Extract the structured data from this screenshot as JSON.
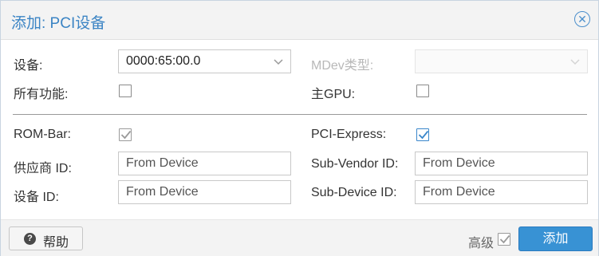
{
  "dialog": {
    "title": "添加: PCI设备",
    "close_icon": "close-circle-icon"
  },
  "fields": {
    "device": {
      "label": "设备:",
      "value": "0000:65:00.0"
    },
    "mdev_type": {
      "label": "MDev类型:",
      "value": "",
      "disabled": true
    },
    "all_functions": {
      "label": "所有功能:",
      "checked": false
    },
    "primary_gpu": {
      "label": "主GPU:",
      "checked": false
    },
    "rom_bar": {
      "label": "ROM-Bar:",
      "checked": true,
      "disabled": true
    },
    "pci_express": {
      "label": "PCI-Express:",
      "checked": true
    },
    "vendor_id": {
      "label": "供应商 ID:",
      "placeholder": "From Device"
    },
    "sub_vendor_id": {
      "label": "Sub-Vendor ID:",
      "placeholder": "From Device"
    },
    "device_id": {
      "label": "设备 ID:",
      "placeholder": "From Device"
    },
    "sub_device_id": {
      "label": "Sub-Device ID:",
      "placeholder": "From Device"
    }
  },
  "footer": {
    "help_label": "帮助",
    "help_icon": "question-circle-icon",
    "advanced_label": "高级",
    "advanced_checked": true,
    "add_label": "添加"
  },
  "colors": {
    "accent": "#3892d4",
    "title": "#3b84c4",
    "disabled_text": "#b8b8b8"
  }
}
